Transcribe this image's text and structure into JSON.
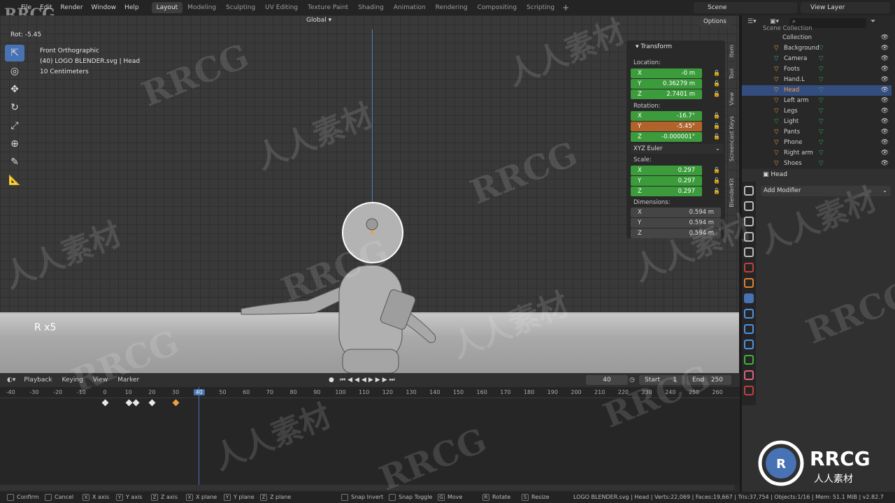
{
  "app": {
    "corner_watermark": "RRCG"
  },
  "menu": [
    "File",
    "Edit",
    "Render",
    "Window",
    "Help"
  ],
  "workspaces": [
    "Layout",
    "Modeling",
    "Sculpting",
    "UV Editing",
    "Texture Paint",
    "Shading",
    "Animation",
    "Rendering",
    "Compositing",
    "Scripting"
  ],
  "active_workspace": "Layout",
  "scene": "Scene",
  "view_layer": "View Layer",
  "viewport": {
    "orientation": "Global",
    "options_label": "Options",
    "rotation_readout": "Rot: -5.45",
    "view_name": "Front Orthographic",
    "object_info": "(40) LOGO BLENDER.svg | Head",
    "scale_info": "10 Centimeters",
    "key_overlay": "R x5"
  },
  "transform": {
    "title": "Transform",
    "location_label": "Location:",
    "location": [
      {
        "axis": "X",
        "value": "-0 m"
      },
      {
        "axis": "Y",
        "value": "0.36279 m"
      },
      {
        "axis": "Z",
        "value": "2.7401 m"
      }
    ],
    "rotation_label": "Rotation:",
    "rotation": [
      {
        "axis": "X",
        "value": "-16.7°"
      },
      {
        "axis": "Y",
        "value": "-5.45°"
      },
      {
        "axis": "Z",
        "value": "-0.000001°"
      }
    ],
    "rotation_mode": "XYZ Euler",
    "scale_label": "Scale:",
    "scale": [
      {
        "axis": "X",
        "value": "0.297"
      },
      {
        "axis": "Y",
        "value": "0.297"
      },
      {
        "axis": "Z",
        "value": "0.297"
      }
    ],
    "dimensions_label": "Dimensions:",
    "dimensions": [
      {
        "axis": "X",
        "value": "0.594 m"
      },
      {
        "axis": "Y",
        "value": "0.594 m"
      },
      {
        "axis": "Z",
        "value": "0.594 m"
      }
    ]
  },
  "side_tabs": [
    "Item",
    "Tool",
    "View",
    "Screencast Keys",
    "BlenderKit"
  ],
  "outliner": {
    "root": "Scene Collection",
    "collection": "Collection",
    "items": [
      "Background",
      "Camera",
      "Foots",
      "Hand.L",
      "Head",
      "Left arm",
      "Legs",
      "Light",
      "Pants",
      "Phone",
      "Right arm",
      "Shoes"
    ],
    "selected": "Head"
  },
  "properties": {
    "object": "Head",
    "add_modifier": "Add Modifier"
  },
  "timeline": {
    "menus": [
      "Playback",
      "Keying",
      "View",
      "Marker"
    ],
    "current_frame": "40",
    "start_label": "Start",
    "start": "1",
    "end_label": "End",
    "end": "250",
    "ticks": [
      "-40",
      "-30",
      "-20",
      "-10",
      "0",
      "10",
      "20",
      "30",
      "40",
      "50",
      "60",
      "70",
      "80",
      "90",
      "100",
      "110",
      "120",
      "130",
      "140",
      "150",
      "160",
      "170",
      "180",
      "190",
      "200",
      "210",
      "220",
      "230",
      "240",
      "250",
      "260"
    ],
    "keyframes": [
      0,
      10,
      13,
      20,
      30
    ]
  },
  "statusbar": {
    "items": [
      {
        "key": "",
        "label": "Confirm"
      },
      {
        "key": "",
        "label": "Cancel"
      },
      {
        "key": "X",
        "label": "X axis"
      },
      {
        "key": "Y",
        "label": "Y axis"
      },
      {
        "key": "Z",
        "label": "Z axis"
      },
      {
        "key": "X",
        "label": "X plane"
      },
      {
        "key": "Y",
        "label": "Y plane"
      },
      {
        "key": "Z",
        "label": "Z plane"
      },
      {
        "key": "",
        "label": "Snap Invert"
      },
      {
        "key": "",
        "label": "Snap Toggle"
      },
      {
        "key": "G",
        "label": "Move"
      },
      {
        "key": "R",
        "label": "Rotate"
      },
      {
        "key": "S",
        "label": "Resize"
      }
    ],
    "stats": "LOGO BLENDER.svg | Head | Verts:22,069 | Faces:19,667 | Tris:37,754 | Objects:1/16 | Mem: 51.1 MiB | v2.82.7"
  },
  "colors": {
    "accent": "#4772b3",
    "location_field": "#3c9c3c",
    "keyed_field": "#b0642b",
    "object_orange": "#f0a040"
  },
  "brand_logo": {
    "name": "RRCG",
    "subtitle": "人人素材"
  }
}
